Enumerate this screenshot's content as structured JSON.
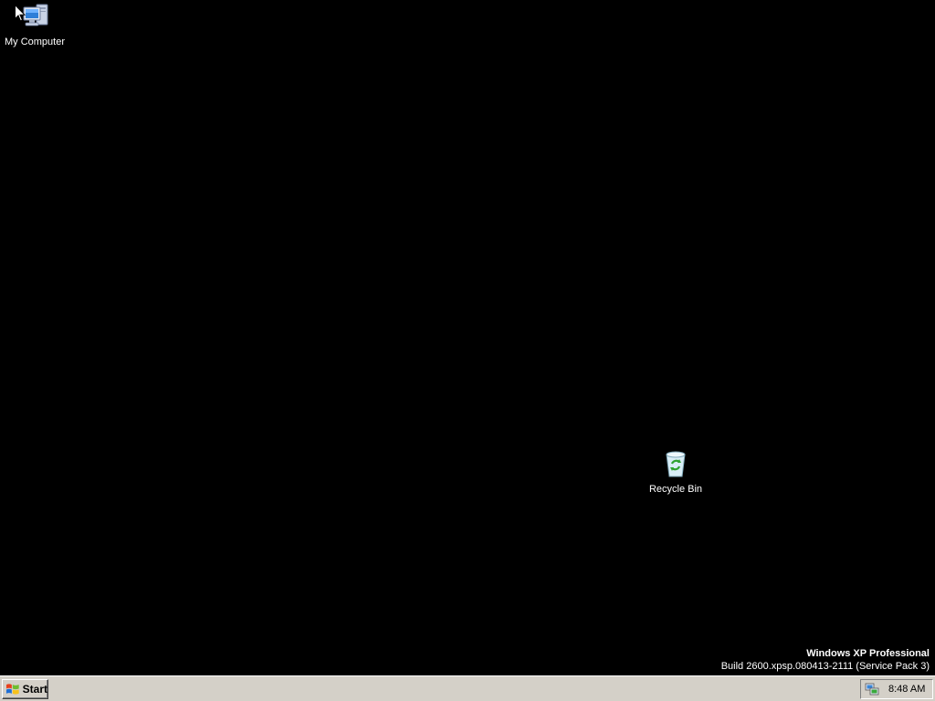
{
  "desktop": {
    "background_color": "#000000",
    "icons": [
      {
        "label": "My Computer",
        "icon": "my-computer-icon"
      },
      {
        "label": "Recycle Bin",
        "icon": "recycle-bin-icon"
      }
    ]
  },
  "watermark": {
    "line1": "Windows XP Professional",
    "line2": "Build 2600.xpsp.080413-2111 (Service Pack 3)"
  },
  "taskbar": {
    "start_label": "Start",
    "start_icon": "windows-flag-icon",
    "tray_icons": [
      "network-connection-icon"
    ],
    "clock": "8:48 AM",
    "background_color": "#d4d0c8"
  }
}
